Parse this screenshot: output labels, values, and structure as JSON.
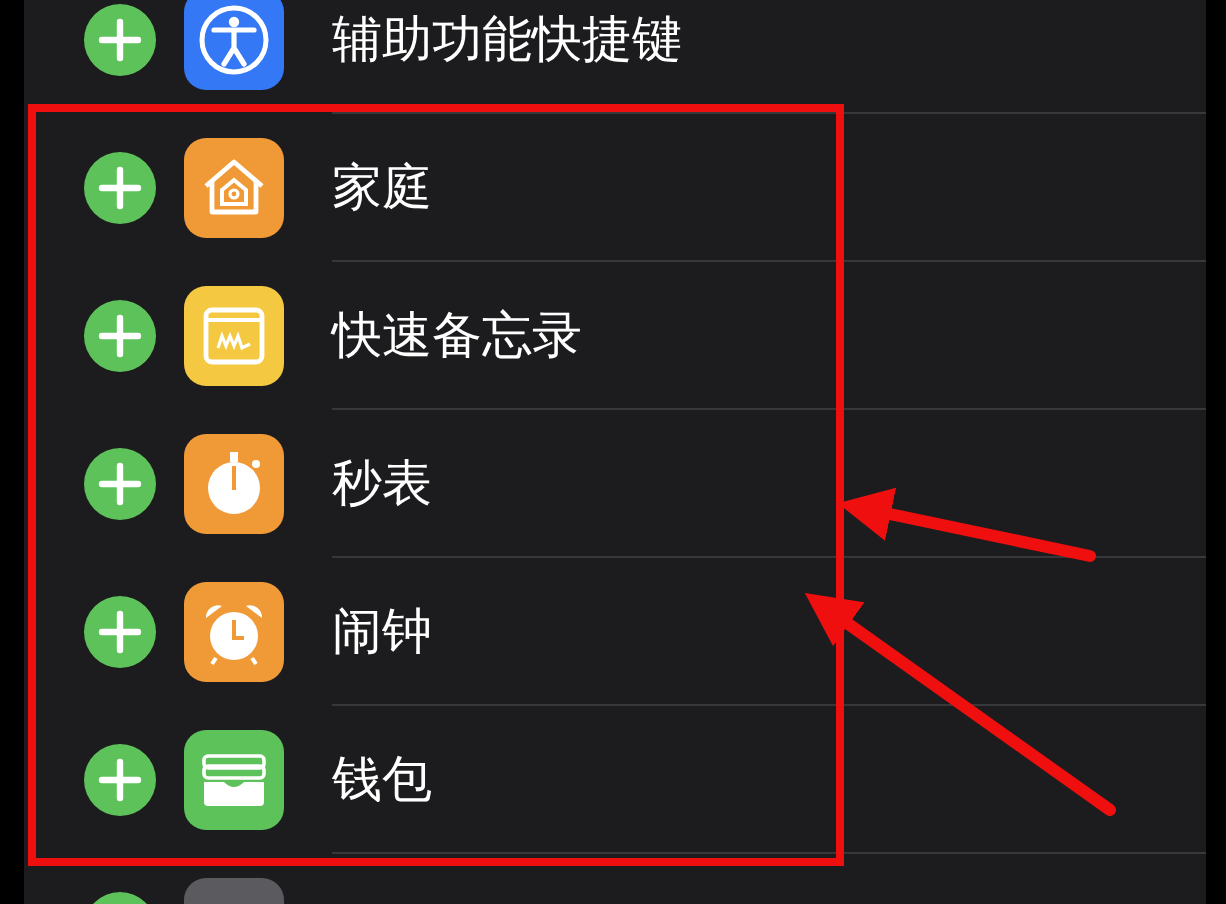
{
  "items": [
    {
      "label": "辅助功能快捷键",
      "kind": "accessibility",
      "color": "#3478f6"
    },
    {
      "label": "家庭",
      "kind": "home",
      "color": "#f09a37"
    },
    {
      "label": "快速备忘录",
      "kind": "note",
      "color": "#f5c842"
    },
    {
      "label": "秒表",
      "kind": "stopwatch",
      "color": "#f09a37"
    },
    {
      "label": "闹钟",
      "kind": "alarm",
      "color": "#f09a37"
    },
    {
      "label": "钱包",
      "kind": "wallet",
      "color": "#5ec25a"
    },
    {
      "kind": "unknown",
      "color": "#5b5b5f"
    }
  ],
  "annotations": [
    {
      "kind": "box"
    },
    {
      "kind": "arrow"
    },
    {
      "kind": "arrow"
    }
  ]
}
